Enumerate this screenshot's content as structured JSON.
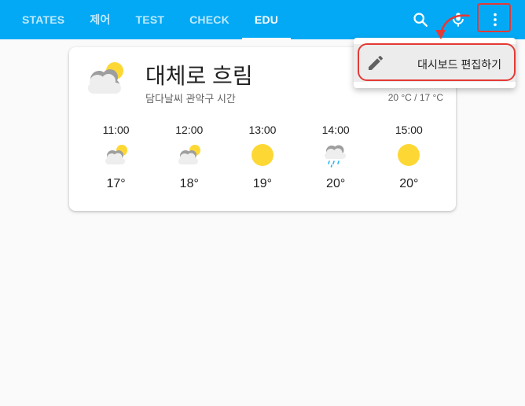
{
  "header": {
    "tabs": [
      {
        "label": "STATES",
        "active": false
      },
      {
        "label": "제어",
        "active": false
      },
      {
        "label": "TEST",
        "active": false
      },
      {
        "label": "CHECK",
        "active": false
      },
      {
        "label": "EDU",
        "active": true
      }
    ],
    "icons": [
      "search-icon",
      "microphone-icon",
      "more-vert-icon"
    ],
    "color": "#03a9f4"
  },
  "weather": {
    "condition": "대체로 흐림",
    "location": "담다날씨 관악구 시간",
    "temp_range": "20 °C / 17 °C",
    "icon": "partly-cloudy-icon",
    "forecast": [
      {
        "time": "11:00",
        "temp": "17°",
        "icon": "partly-cloudy-icon"
      },
      {
        "time": "12:00",
        "temp": "18°",
        "icon": "partly-cloudy-icon"
      },
      {
        "time": "13:00",
        "temp": "19°",
        "icon": "sunny-icon"
      },
      {
        "time": "14:00",
        "temp": "20°",
        "icon": "rainy-icon"
      },
      {
        "time": "15:00",
        "temp": "20°",
        "icon": "sunny-icon"
      }
    ]
  },
  "menu": {
    "edit_label": "대시보드 편집하기",
    "icon": "pencil-icon"
  },
  "annotation_color": "#e53935"
}
